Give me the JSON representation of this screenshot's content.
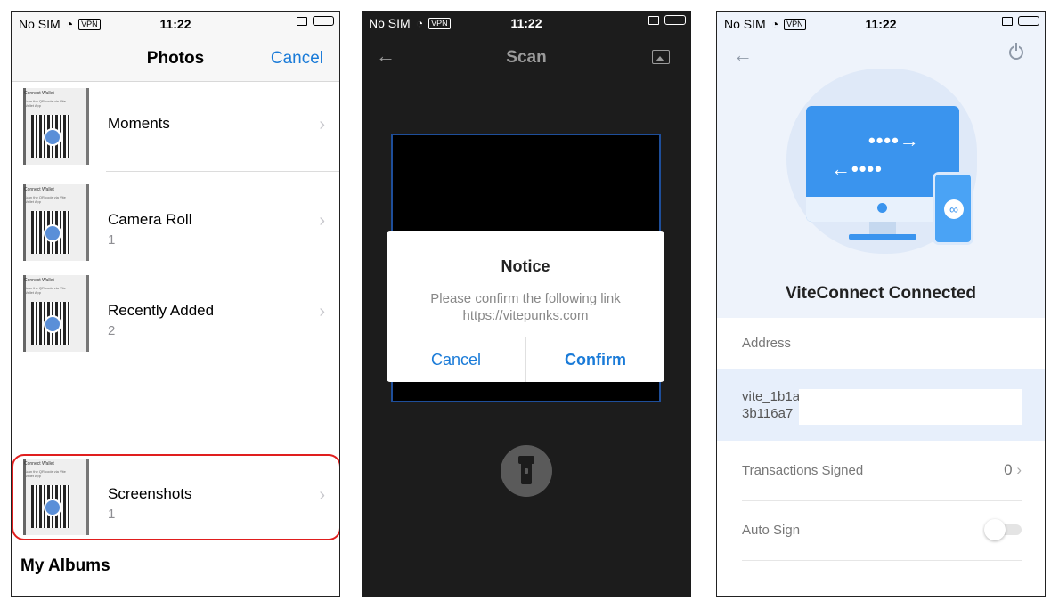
{
  "status_bars": [
    {
      "carrier": "No SIM",
      "vpn": "VPN",
      "time": "11:22"
    },
    {
      "carrier": "No SIM",
      "vpn": "VPN",
      "time": "11:22"
    },
    {
      "carrier": "No SIM",
      "vpn": "VPN",
      "time": "11:22"
    }
  ],
  "photos": {
    "title": "Photos",
    "cancel_label": "Cancel",
    "albums": [
      {
        "name": "Moments",
        "count": ""
      },
      {
        "name": "Camera Roll",
        "count": "1"
      },
      {
        "name": "Recently Added",
        "count": "2"
      },
      {
        "name": "Screenshots",
        "count": "1"
      }
    ],
    "thumb_title": "Connect Wallet",
    "thumb_text": "Scan the QR code via Vite Wallet App",
    "section_title": "My Albums"
  },
  "scan": {
    "title": "Scan",
    "back_icon": "arrow-left-icon",
    "gallery_icon": "image-icon",
    "flash_icon": "flashlight-icon",
    "dialog": {
      "title": "Notice",
      "message": "Please confirm the following link",
      "link": "https://vitepunks.com",
      "cancel_label": "Cancel",
      "confirm_label": "Confirm"
    }
  },
  "viteconnect": {
    "title": "ViteConnect Connected",
    "back_icon": "arrow-left-icon",
    "power_icon": "power-icon",
    "address_label": "Address",
    "address_line1": "vite_1b1a",
    "address_line2": "3b116a7",
    "transactions_label": "Transactions Signed",
    "transactions_count": "0",
    "auto_sign_label": "Auto Sign",
    "auto_sign_on": false
  },
  "colors": {
    "accent": "#1a7bd8",
    "highlight": "#e01e1e",
    "vite_blue": "#3a94ee",
    "battery": "#3ecf3b"
  }
}
